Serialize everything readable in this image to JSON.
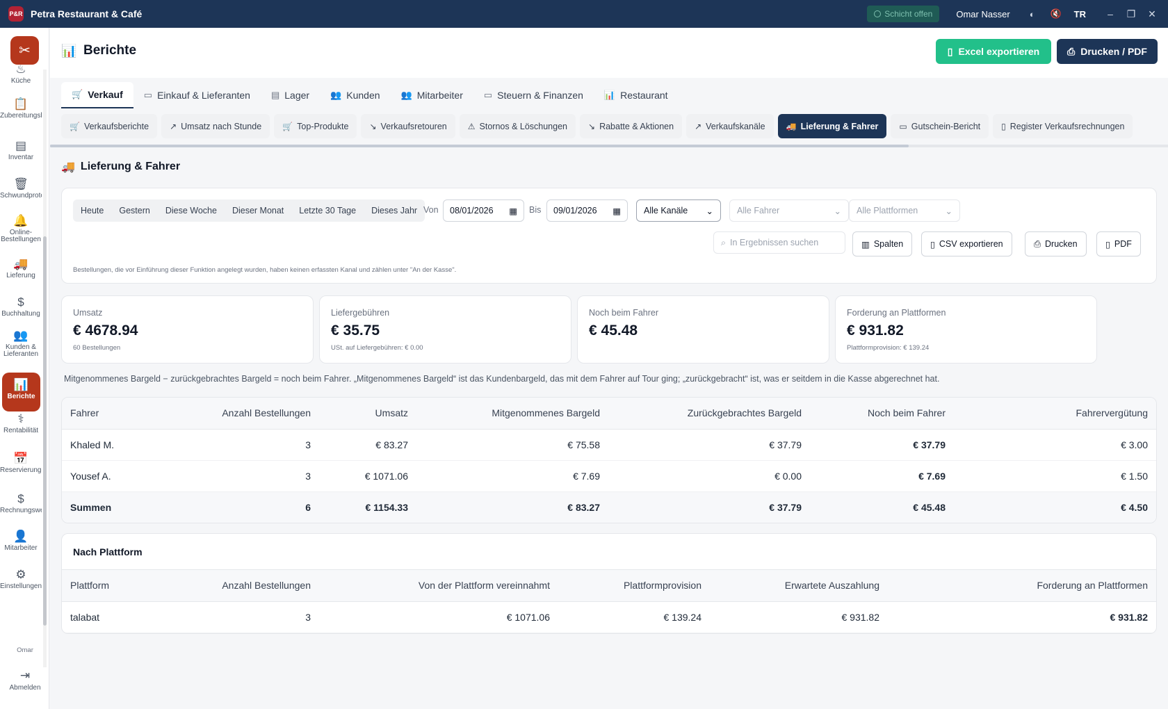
{
  "app": {
    "title": "Petra Restaurant & Café",
    "badge": "P&R"
  },
  "topbar": {
    "shift_status": "Schicht offen",
    "user": "Omar Nasser",
    "language": "TR"
  },
  "sidebar": {
    "items": [
      {
        "label": "Küche",
        "icon": "chef-hat-icon",
        "glyph": "♨"
      },
      {
        "label": "Zubereitungsliste",
        "icon": "clipboard-icon",
        "glyph": "📋"
      },
      {
        "label": "Inventar",
        "icon": "inventory-icon",
        "glyph": "▤"
      },
      {
        "label": "Schwundprotokoll",
        "icon": "trash-icon",
        "glyph": "🗑"
      },
      {
        "label": "Online-\nBestellungen",
        "icon": "bell-icon",
        "glyph": "🔔"
      },
      {
        "label": "Lieferung",
        "icon": "truck-icon",
        "glyph": "🚚"
      },
      {
        "label": "Buchhaltung",
        "icon": "dollar-icon",
        "glyph": "$"
      },
      {
        "label": "Kunden &\nLieferanten",
        "icon": "users-icon",
        "glyph": "👥"
      },
      {
        "label": "Berichte",
        "icon": "bar-chart-icon",
        "glyph": "📊"
      },
      {
        "label": "Rentabilität",
        "icon": "stethoscope-icon",
        "glyph": "⚕"
      },
      {
        "label": "Reservierungen",
        "icon": "calendar-icon",
        "glyph": "📅"
      },
      {
        "label": "Rechnungswesen",
        "icon": "receipt-icon",
        "glyph": "$"
      },
      {
        "label": "Mitarbeiter",
        "icon": "user-icon",
        "glyph": "👤"
      },
      {
        "label": "Einstellungen",
        "icon": "gear-icon",
        "glyph": "⚙"
      }
    ],
    "user_short": "Omar",
    "logout": "Abmelden"
  },
  "page": {
    "title": "Berichte",
    "export_excel": "Excel exportieren",
    "print_pdf": "Drucken / PDF"
  },
  "tabs": [
    {
      "label": "Verkauf",
      "glyph": "🛒"
    },
    {
      "label": "Einkauf & Lieferanten",
      "glyph": "▭"
    },
    {
      "label": "Lager",
      "glyph": "▤"
    },
    {
      "label": "Kunden",
      "glyph": "👥"
    },
    {
      "label": "Mitarbeiter",
      "glyph": "👥"
    },
    {
      "label": "Steuern & Finanzen",
      "glyph": "▭"
    },
    {
      "label": "Restaurant",
      "glyph": "📊"
    }
  ],
  "subtabs": [
    {
      "label": "Verkaufsberichte",
      "glyph": "🛒"
    },
    {
      "label": "Umsatz nach Stunde",
      "glyph": "↗"
    },
    {
      "label": "Top-Produkte",
      "glyph": "🛒"
    },
    {
      "label": "Verkaufsretouren",
      "glyph": "↘"
    },
    {
      "label": "Stornos & Löschungen",
      "glyph": "⚠"
    },
    {
      "label": "Rabatte & Aktionen",
      "glyph": "↘"
    },
    {
      "label": "Verkaufskanäle",
      "glyph": "↗"
    },
    {
      "label": "Lieferung & Fahrer",
      "glyph": "🚚"
    },
    {
      "label": "Gutschein-Bericht",
      "glyph": "▭"
    },
    {
      "label": "Register Verkaufsrechnungen",
      "glyph": "▯"
    }
  ],
  "section": {
    "title": "Lieferung & Fahrer"
  },
  "filters": {
    "quick": [
      "Heute",
      "Gestern",
      "Diese Woche",
      "Dieser Monat",
      "Letzte 30 Tage",
      "Dieses Jahr"
    ],
    "from_label": "Von",
    "from_value": "08/01/2026",
    "to_label": "Bis",
    "to_value": "09/01/2026",
    "channel": "Alle Kanäle",
    "driver": "Alle Fahrer",
    "platform": "Alle Plattformen",
    "search_placeholder": "In Ergebnissen suchen",
    "columns": "Spalten",
    "csv": "CSV exportieren",
    "print": "Drucken",
    "pdf": "PDF",
    "note": "Bestellungen, die vor Einführung dieser Funktion angelegt wurden, haben keinen erfassten Kanal und zählen unter \"An der Kasse\"."
  },
  "kpis": [
    {
      "label": "Umsatz",
      "value": "€ 4678.94",
      "sub": "60 Bestellungen"
    },
    {
      "label": "Liefergebühren",
      "value": "€ 35.75",
      "sub": "USt. auf Liefergebühren: € 0.00"
    },
    {
      "label": "Noch beim Fahrer",
      "value": "€ 45.48",
      "sub": ""
    },
    {
      "label": "Forderung an Plattformen",
      "value": "€ 931.82",
      "sub": "Plattformprovision: € 139.24"
    }
  ],
  "explain": "Mitgenommenes Bargeld − zurückgebrachtes Bargeld = noch beim Fahrer. „Mitgenommenes Bargeld“ ist das Kundenbargeld, das mit dem Fahrer auf Tour ging; „zurückgebracht“ ist, was er seitdem in die Kasse abgerechnet hat.",
  "drivers_table": {
    "headers": [
      "Fahrer",
      "Anzahl Bestellungen",
      "Umsatz",
      "Mitgenommenes Bargeld",
      "Zurückgebrachtes Bargeld",
      "Noch beim Fahrer",
      "Fahrervergütung"
    ],
    "rows": [
      [
        "Khaled M.",
        "3",
        "€ 83.27",
        "€ 75.58",
        "€ 37.79",
        "€ 37.79",
        "€ 3.00"
      ],
      [
        "Yousef A.",
        "3",
        "€ 1071.06",
        "€ 7.69",
        "€ 0.00",
        "€ 7.69",
        "€ 1.50"
      ]
    ],
    "totals": [
      "Summen",
      "6",
      "€ 1154.33",
      "€ 83.27",
      "€ 37.79",
      "€ 45.48",
      "€ 4.50"
    ]
  },
  "platform_table": {
    "title": "Nach Plattform",
    "headers": [
      "Plattform",
      "Anzahl Bestellungen",
      "Von der Plattform vereinnahmt",
      "Plattformprovision",
      "Erwartete Auszahlung",
      "Forderung an Plattformen"
    ],
    "rows": [
      [
        "talabat",
        "3",
        "€ 1071.06",
        "€ 139.24",
        "€ 931.82",
        "€ 931.82"
      ]
    ]
  },
  "colors": {
    "navy": "#1d3557",
    "brand": "#b5371c",
    "green": "#22c08a"
  }
}
